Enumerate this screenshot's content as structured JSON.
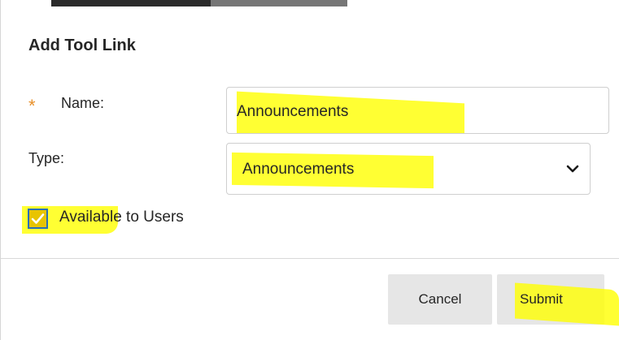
{
  "dialog": {
    "title": "Add Tool Link"
  },
  "name_field": {
    "required_marker": "*",
    "label": "Name:",
    "value": "Announcements"
  },
  "type_field": {
    "label": "Type:",
    "selected": "Announcements"
  },
  "availability": {
    "label": "Available to Users",
    "checked": true
  },
  "actions": {
    "cancel_label": "Cancel",
    "submit_label": "Submit"
  },
  "icons": {
    "dropdown": "chevron-down-icon",
    "checkmark": "checkmark-icon"
  },
  "colors": {
    "highlight": "#ffff00",
    "required_star": "#e8902a",
    "checkbox_border": "#2a6fb7",
    "button_bg": "#e6e6e6"
  }
}
